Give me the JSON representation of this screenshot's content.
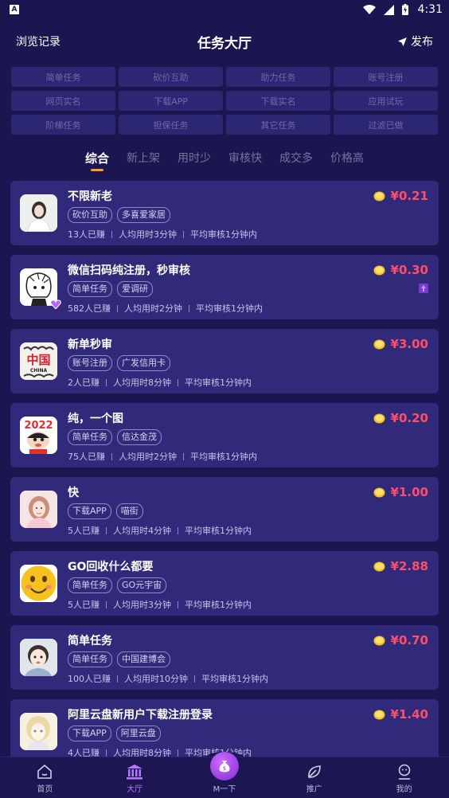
{
  "status_bar": {
    "time": "4:31",
    "notification_letter": "A"
  },
  "header": {
    "left": "浏览记录",
    "title": "任务大厅",
    "right": "发布"
  },
  "filters": [
    "简单任务",
    "砍价互助",
    "助力任务",
    "账号注册",
    "网页实名",
    "下载APP",
    "下载实名",
    "应用试玩",
    "阶梯任务",
    "担保任务",
    "其它任务",
    "过滤已做"
  ],
  "sort_tabs": [
    {
      "label": "综合",
      "active": true
    },
    {
      "label": "新上架",
      "active": false
    },
    {
      "label": "用时少",
      "active": false
    },
    {
      "label": "审核快",
      "active": false
    },
    {
      "label": "成交多",
      "active": false
    },
    {
      "label": "价格高",
      "active": false
    }
  ],
  "tasks": [
    {
      "title": "不限新老",
      "tags": [
        "砍价互助",
        "多喜爱家居"
      ],
      "done": "13人已赚",
      "avg_time": "人均用时3分钟",
      "review": "平均审核1分钟内",
      "price": "¥0.21",
      "avatar": "avatar-girl-white"
    },
    {
      "title": "微信扫码纯注册，秒审核",
      "tags": [
        "简单任务",
        "爱调研"
      ],
      "done": "582人已赚",
      "avg_time": "人均用时2分钟",
      "review": "平均审核1分钟内",
      "price": "¥0.30",
      "avatar": "avatar-sketch",
      "vip": true,
      "pinned": true
    },
    {
      "title": "新单秒审",
      "tags": [
        "账号注册",
        "广发信用卡"
      ],
      "done": "2人已赚",
      "avg_time": "人均用时8分钟",
      "review": "平均审核1分钟内",
      "price": "¥3.00",
      "avatar": "avatar-china"
    },
    {
      "title": "纯，一个图",
      "tags": [
        "简单任务",
        "信达金茂"
      ],
      "done": "75人已赚",
      "avg_time": "人均用时2分钟",
      "review": "平均审核1分钟内",
      "price": "¥0.20",
      "avatar": "avatar-2022"
    },
    {
      "title": "快",
      "tags": [
        "下载APP",
        "喵街"
      ],
      "done": "5人已赚",
      "avg_time": "人均用时4分钟",
      "review": "平均审核1分钟内",
      "price": "¥1.00",
      "avatar": "avatar-girl-pink"
    },
    {
      "title": "GO回收什么都要",
      "tags": [
        "简单任务",
        "GO元宇宙"
      ],
      "done": "5人已赚",
      "avg_time": "人均用时3分钟",
      "review": "平均审核1分钟内",
      "price": "¥2.88",
      "avatar": "avatar-smiley"
    },
    {
      "title": "简单任务",
      "tags": [
        "简单任务",
        "中国建博会"
      ],
      "done": "100人已赚",
      "avg_time": "人均用时10分钟",
      "review": "平均审核1分钟内",
      "price": "¥0.70",
      "avatar": "avatar-child"
    },
    {
      "title": "阿里云盘新用户下载注册登录",
      "tags": [
        "下载APP",
        "阿里云盘"
      ],
      "done": "4人已赚",
      "avg_time": "人均用时8分钟",
      "review": "平均审核1分钟内",
      "price": "¥1.40",
      "avatar": "avatar-anime"
    }
  ],
  "bottom_nav": [
    {
      "label": "首页",
      "icon": "home-icon",
      "active": false
    },
    {
      "label": "大厅",
      "icon": "hall-icon",
      "active": true
    },
    {
      "label": "M一下",
      "icon": "money-bag-icon",
      "active": false
    },
    {
      "label": "推广",
      "icon": "leaf-icon",
      "active": false
    },
    {
      "label": "我的",
      "icon": "profile-icon",
      "active": false
    }
  ],
  "colors": {
    "background": "#1b1650",
    "card": "#312a7a",
    "price": "#ff4e6a",
    "accent": "#ff9b1f",
    "nav_active": "#b478ff"
  }
}
